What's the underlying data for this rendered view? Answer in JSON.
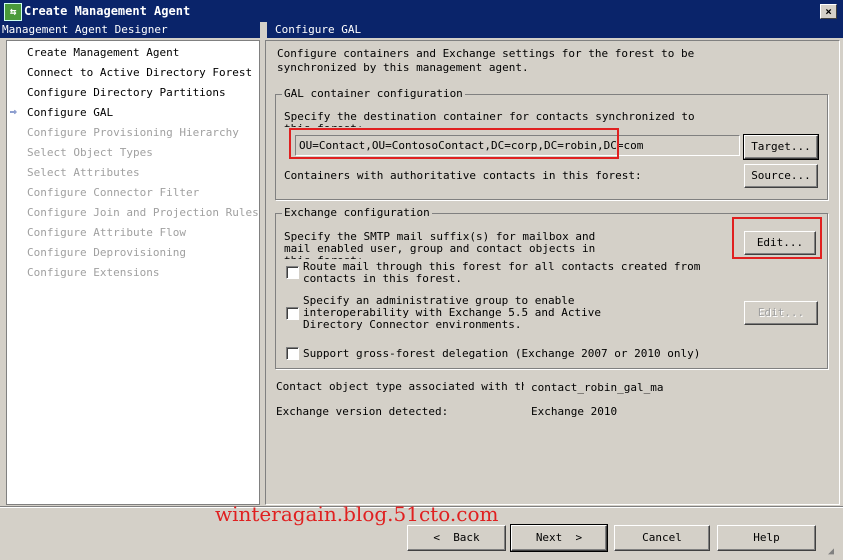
{
  "window": {
    "title": "Create Management Agent",
    "icon": "agent-icon",
    "close": "×"
  },
  "sidebar": {
    "header": "Management Agent Designer",
    "current_marker": "⇨",
    "items": [
      {
        "label": "Create Management Agent",
        "enabled": true
      },
      {
        "label": "Connect to Active Directory Forest",
        "enabled": true
      },
      {
        "label": "Configure Directory Partitions",
        "enabled": true
      },
      {
        "label": "Configure GAL",
        "enabled": true,
        "current": true
      },
      {
        "label": "Configure Provisioning Hierarchy",
        "enabled": false
      },
      {
        "label": "Select Object Types",
        "enabled": false
      },
      {
        "label": "Select Attributes",
        "enabled": false
      },
      {
        "label": "Configure Connector Filter",
        "enabled": false
      },
      {
        "label": "Configure Join and Projection Rules",
        "enabled": false
      },
      {
        "label": "Configure Attribute Flow",
        "enabled": false
      },
      {
        "label": "Configure Deprovisioning",
        "enabled": false
      },
      {
        "label": "Configure Extensions",
        "enabled": false
      }
    ]
  },
  "main": {
    "header": "Configure GAL",
    "intro1": "Configure containers and Exchange settings for the forest to be",
    "intro2": "synchronized by this management agent.",
    "gal": {
      "legend": "GAL container configuration",
      "desc1": "Specify the destination container for contacts synchronized to",
      "desc2": "this forest:",
      "target_value": "OU=Contact,OU=ContosoContact,DC=corp,DC=robin,DC=com",
      "target_button": "Target...",
      "containers_label": "Containers with authoritative contacts in this forest:",
      "source_button": "Source..."
    },
    "exchange": {
      "legend": "Exchange configuration",
      "smtp1": "Specify the SMTP mail suffix(s) for mailbox and",
      "smtp2": "mail enabled user, group and contact objects in",
      "smtp3": "this forest:",
      "edit_button": "Edit...",
      "route1": "Route mail through this forest for all contacts created from",
      "route2": "contacts in this forest.",
      "route_checked": false,
      "admin1": "Specify an administrative group to enable",
      "admin2": "interoperability with Exchange 5.5 and Active",
      "admin3": "Directory Connector environments.",
      "admin_checked": false,
      "admin_edit_button": "Edit...",
      "gross": "Support gross-forest delegation (Exchange 2007 or 2010 only)",
      "gross_checked": false
    },
    "contact_type_label": "Contact object type associated with this forest:",
    "contact_type_value": "contact_robin_gal_ma",
    "exchange_version_label": "Exchange version detected:",
    "exchange_version_value": "Exchange 2010"
  },
  "footer": {
    "back": "Back",
    "next": "Next",
    "cancel": "Cancel",
    "help": "Help",
    "watermark": "winteragain.blog.51cto.com"
  },
  "colors": {
    "titlebar": "#0a246a",
    "highlight": "#e02020"
  }
}
